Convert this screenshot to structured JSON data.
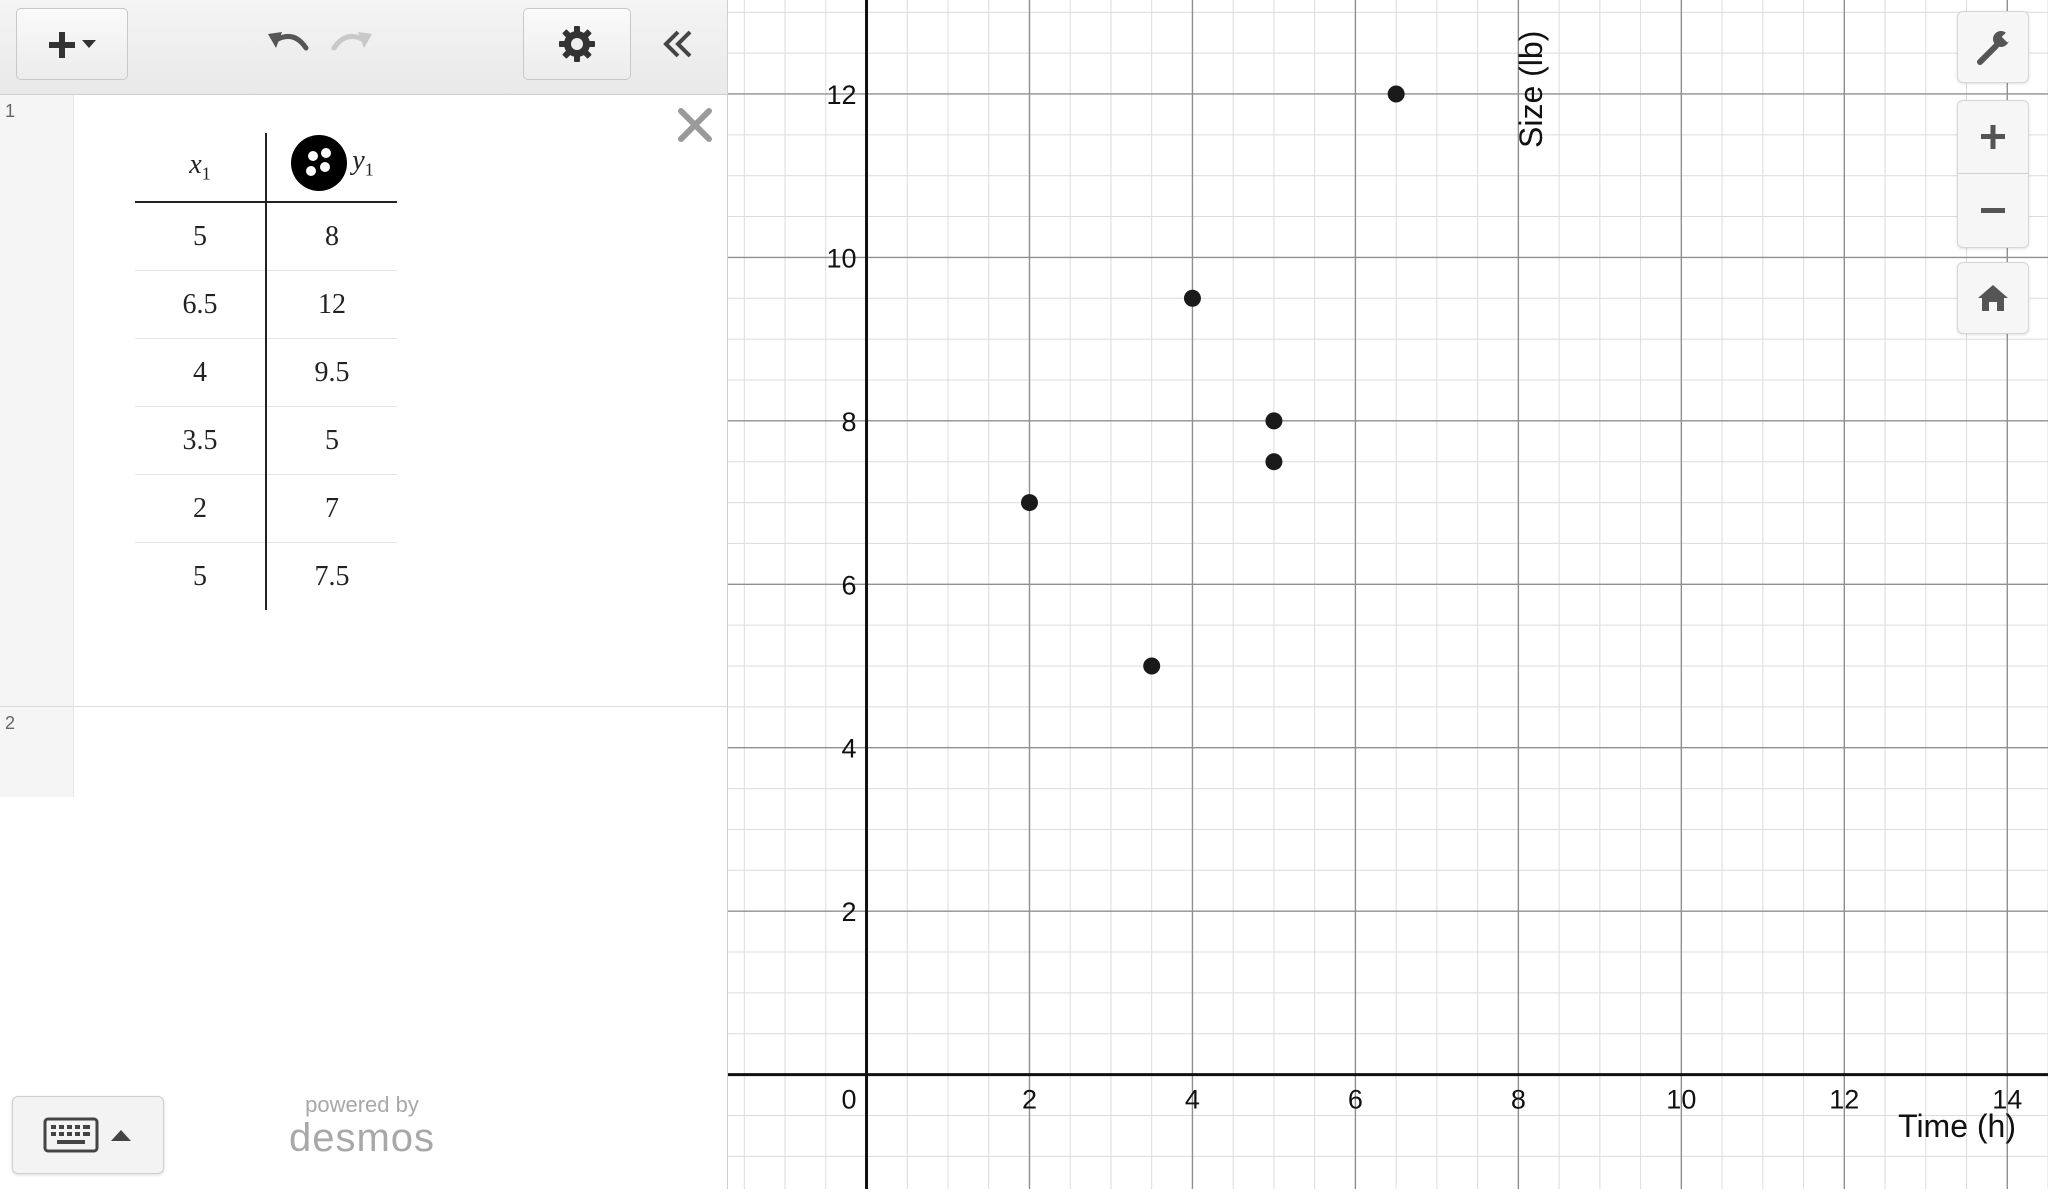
{
  "toolbar": {
    "add_icon": "plus-icon",
    "undo_icon": "undo-icon",
    "redo_icon": "redo-icon",
    "settings_icon": "gear-icon",
    "collapse_icon": "double-chevron-left-icon"
  },
  "expressions": [
    {
      "number": "1",
      "type": "table",
      "columns": [
        {
          "var": "x",
          "sub": "1"
        },
        {
          "var": "y",
          "sub": "1"
        }
      ],
      "rows": [
        [
          "5",
          "8"
        ],
        [
          "6.5",
          "12"
        ],
        [
          "4",
          "9.5"
        ],
        [
          "3.5",
          "5"
        ],
        [
          "2",
          "7"
        ],
        [
          "5",
          "7.5"
        ]
      ],
      "point_style_icon": "points-icon",
      "point_color": "#000000"
    },
    {
      "number": "2",
      "type": "empty"
    }
  ],
  "footer": {
    "keyboard_icon": "keyboard-icon",
    "powered_by": "powered by",
    "brand": "desmos"
  },
  "graph_controls": {
    "wrench_icon": "wrench-icon",
    "zoom_in_icon": "plus-icon",
    "zoom_out_icon": "minus-icon",
    "home_icon": "home-icon"
  },
  "chart_data": {
    "type": "scatter",
    "xlabel": "Time (h)",
    "ylabel": "Size (lb)",
    "xlim": [
      -1.7,
      14.5
    ],
    "ylim": [
      -1.4,
      13.15
    ],
    "x_ticks": [
      2,
      4,
      6,
      8,
      10,
      12,
      14
    ],
    "y_ticks": [
      2,
      4,
      6,
      8,
      10,
      12
    ],
    "origin_label": "0",
    "grid": true,
    "minor_step": 0.5,
    "major_step": 2,
    "series": [
      {
        "points": [
          [
            5,
            8
          ],
          [
            6.5,
            12
          ],
          [
            4,
            9.5
          ],
          [
            3.5,
            5
          ],
          [
            2,
            7
          ],
          [
            5,
            7.5
          ]
        ],
        "color": "#1a1a1a"
      }
    ]
  }
}
